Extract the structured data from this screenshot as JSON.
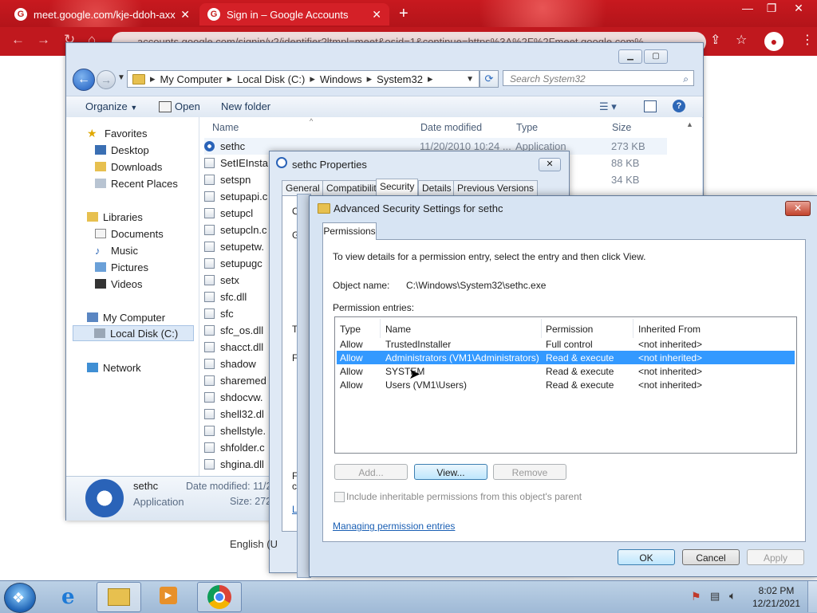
{
  "browser": {
    "tabs": [
      {
        "label": "meet.google.com/kje-ddoh-axx"
      },
      {
        "label": "Sign in – Google Accounts"
      }
    ],
    "new_tab": "+",
    "address": "accounts.google.com/signin/v2/identifier?ltmpl=meet&osid=1&continue=https%3A%2F%2Fmeet.google.com%"
  },
  "explorer": {
    "breadcrumb": [
      "My Computer",
      "Local Disk (C:)",
      "Windows",
      "System32"
    ],
    "search_placeholder": "Search System32",
    "toolbar": {
      "organize": "Organize",
      "open": "Open",
      "new_folder": "New folder"
    },
    "nav": {
      "favorites": "Favorites",
      "desktop": "Desktop",
      "downloads": "Downloads",
      "recent": "Recent Places",
      "libraries": "Libraries",
      "documents": "Documents",
      "music": "Music",
      "pictures": "Pictures",
      "videos": "Videos",
      "computer": "My Computer",
      "local_disk": "Local Disk (C:)",
      "network": "Network"
    },
    "columns": {
      "name": "Name",
      "date": "Date modified",
      "type": "Type",
      "size": "Size"
    },
    "files": [
      {
        "name": "sethc",
        "date": "11/20/2010 10:24 ...",
        "type": "Application",
        "size": "273 KB"
      },
      {
        "name": "SetIEInsta",
        "date": "",
        "type": "",
        "size": "88 KB"
      },
      {
        "name": "setspn",
        "date": "",
        "type": "",
        "size": "34 KB"
      },
      {
        "name": "setupapi.c",
        "date": "",
        "type": "",
        "size": ""
      },
      {
        "name": "setupcl",
        "date": "",
        "type": "",
        "size": ""
      },
      {
        "name": "setupcln.c",
        "date": "",
        "type": "",
        "size": ""
      },
      {
        "name": "setupetw.",
        "date": "",
        "type": "",
        "size": ""
      },
      {
        "name": "setupugc",
        "date": "",
        "type": "",
        "size": ""
      },
      {
        "name": "setx",
        "date": "",
        "type": "",
        "size": ""
      },
      {
        "name": "sfc.dll",
        "date": "",
        "type": "",
        "size": ""
      },
      {
        "name": "sfc",
        "date": "",
        "type": "",
        "size": ""
      },
      {
        "name": "sfc_os.dll",
        "date": "",
        "type": "",
        "size": ""
      },
      {
        "name": "shacct.dll",
        "date": "",
        "type": "",
        "size": ""
      },
      {
        "name": "shadow",
        "date": "",
        "type": "",
        "size": ""
      },
      {
        "name": "sharemed",
        "date": "",
        "type": "",
        "size": ""
      },
      {
        "name": "shdocvw.",
        "date": "",
        "type": "",
        "size": ""
      },
      {
        "name": "shell32.dl",
        "date": "",
        "type": "",
        "size": ""
      },
      {
        "name": "shellstyle.",
        "date": "",
        "type": "",
        "size": ""
      },
      {
        "name": "shfolder.c",
        "date": "",
        "type": "",
        "size": ""
      },
      {
        "name": "shgina.dll",
        "date": "",
        "type": "",
        "size": ""
      }
    ],
    "details": {
      "name": "sethc",
      "kind": "Application",
      "date_label": "Date modified: 11/2",
      "size_label": "Size: 272"
    }
  },
  "properties": {
    "title": "sethc Properties",
    "tabs": [
      "General",
      "Compatibility",
      "Security",
      "Details",
      "Previous Versions"
    ],
    "fragments": [
      "O",
      "G",
      "T",
      "F",
      "F",
      "c",
      "L"
    ],
    "language": "English (U"
  },
  "advanced": {
    "title": "Advanced Security Settings for sethc",
    "tab": "Permissions",
    "intro": "To view details for a permission entry, select the entry and then click View.",
    "object_label": "Object name:",
    "object_value": "C:\\Windows\\System32\\sethc.exe",
    "entries_label": "Permission entries:",
    "headers": {
      "type": "Type",
      "name": "Name",
      "permission": "Permission",
      "inherited": "Inherited From"
    },
    "entries": [
      {
        "type": "Allow",
        "name": "TrustedInstaller",
        "permission": "Full control",
        "inherited": "<not inherited>"
      },
      {
        "type": "Allow",
        "name": "Administrators (VM1\\Administrators)",
        "permission": "Read & execute",
        "inherited": "<not inherited>"
      },
      {
        "type": "Allow",
        "name": "SYSTEM",
        "permission": "Read & execute",
        "inherited": "<not inherited>"
      },
      {
        "type": "Allow",
        "name": "Users (VM1\\Users)",
        "permission": "Read & execute",
        "inherited": "<not inherited>"
      }
    ],
    "buttons": {
      "add": "Add...",
      "view": "View...",
      "remove": "Remove",
      "ok": "OK",
      "cancel": "Cancel",
      "apply": "Apply"
    },
    "inherit_checkbox": "Include inheritable permissions from this object's parent",
    "link": "Managing permission entries"
  },
  "taskbar": {
    "time": "8:02 PM",
    "date": "12/21/2021"
  }
}
